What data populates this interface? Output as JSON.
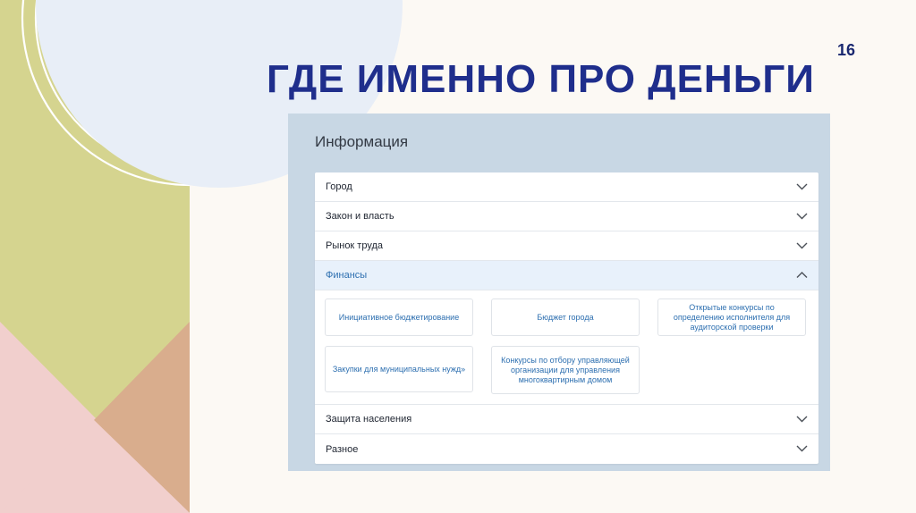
{
  "slide": {
    "number": "16",
    "title": "ГДЕ ИМЕННО ПРО ДЕНЬГИ"
  },
  "panel": {
    "title": "Информация",
    "sections": [
      {
        "label": "Город",
        "state": "collapsed"
      },
      {
        "label": "Закон и власть",
        "state": "collapsed"
      },
      {
        "label": "Рынок труда",
        "state": "collapsed"
      },
      {
        "label": "Финансы",
        "state": "expanded"
      },
      {
        "label": "Защита населения",
        "state": "collapsed"
      },
      {
        "label": "Разное",
        "state": "collapsed"
      }
    ],
    "finance_links": [
      "Инициативное бюджетирование",
      "Бюджет города",
      "Открытые конкурсы по определению исполнителя для аудиторской проверки",
      "Закупки для муниципальных нужд»",
      "Конкурсы по отбору управляющей организации для управления многоквартирным домом"
    ]
  },
  "colors": {
    "title": "#1f2e8c",
    "link": "#2d6fb0",
    "panel_bg": "#c8d7e4",
    "active_row": "#e8f1fb",
    "left_green": "#d5d48f",
    "left_pink": "#f1cfcd",
    "left_tan": "#d9ad8d"
  }
}
